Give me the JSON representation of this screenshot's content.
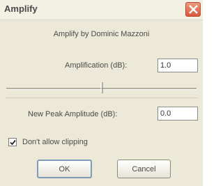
{
  "window": {
    "title": "Amplify"
  },
  "dialog": {
    "subtitle": "Amplify by Dominic Mazzoni",
    "amplification": {
      "label": "Amplification (dB):",
      "value": "1.0"
    },
    "slider": {
      "level": 0.5
    },
    "new_peak": {
      "label": "New Peak Amplitude (dB):",
      "value": "0.0"
    },
    "clipping": {
      "label": "Don't allow clipping",
      "checked": true
    },
    "buttons": {
      "ok": "OK",
      "cancel": "Cancel"
    }
  },
  "colors": {
    "close_button": "#d8583a",
    "background": "#ece9d8"
  }
}
